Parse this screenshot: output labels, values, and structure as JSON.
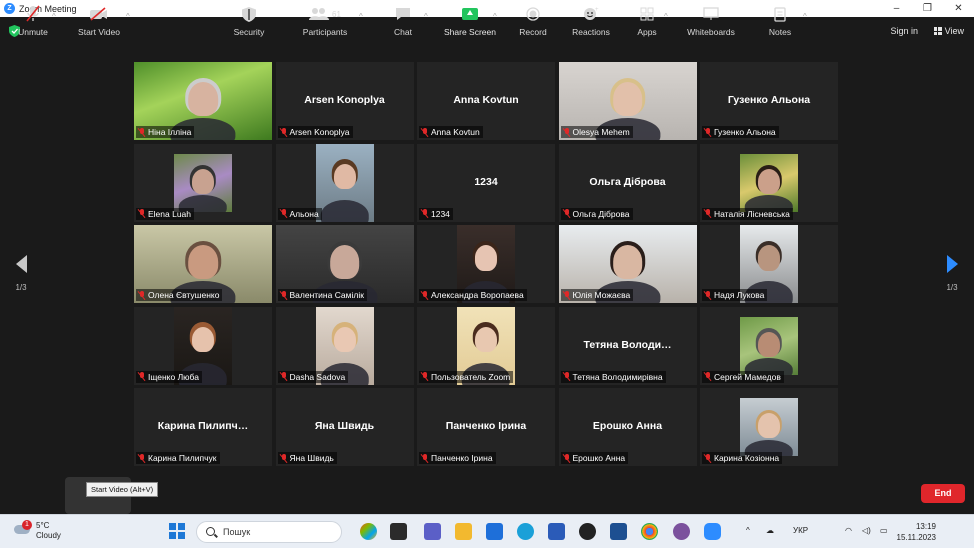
{
  "window": {
    "title": "Zoom Meeting",
    "controls": [
      "–",
      "❐",
      "✕"
    ]
  },
  "topbar": {
    "sign_in": "Sign in",
    "view": "View"
  },
  "pager": {
    "left": "1/3",
    "right": "1/3"
  },
  "tiles": [
    {
      "name": "Ніна Ілліна",
      "big": "",
      "video": "grass",
      "active": true
    },
    {
      "name": "Arsen Konoplya",
      "big": "Arsen Konoplya",
      "video": ""
    },
    {
      "name": "Anna Kovtun",
      "big": "Anna Kovtun",
      "video": ""
    },
    {
      "name": "Olesya Mehem",
      "big": "",
      "video": "office"
    },
    {
      "name": "Гузенко Альона",
      "big": "Гузенко Альона",
      "video": ""
    },
    {
      "name": "Elena Luah",
      "big": "",
      "video": "lilac"
    },
    {
      "name": "Альона",
      "big": "",
      "video": "bus"
    },
    {
      "name": "1234",
      "big": "1234",
      "video": ""
    },
    {
      "name": "Ольга Діброва",
      "big": "Ольга Діброва",
      "video": ""
    },
    {
      "name": "Наталія Лісневська",
      "big": "",
      "video": "garden"
    },
    {
      "name": "Олена Євтушенко",
      "big": "",
      "video": "room-wide"
    },
    {
      "name": "Валентина Самілік",
      "big": "",
      "video": "dark-room"
    },
    {
      "name": "Александра Воропаева",
      "big": "",
      "video": "girl-dark"
    },
    {
      "name": "Юлія Можаєва",
      "big": "",
      "video": "window-wide"
    },
    {
      "name": "Надя Лукова",
      "big": "",
      "video": "window-man"
    },
    {
      "name": "Іщенко Люба",
      "big": "",
      "video": "curly"
    },
    {
      "name": "Dasha Sadova",
      "big": "",
      "video": "blonde"
    },
    {
      "name": "Пользователь Zoom",
      "big": "",
      "video": "beige"
    },
    {
      "name": "Тетяна Володимирівна",
      "big": "Тетяна Володи…",
      "video": ""
    },
    {
      "name": "Сергей Мамедов",
      "big": "",
      "video": "man-outdoor"
    },
    {
      "name": "Карина Пилипчук",
      "big": "Карина Пилипч…",
      "video": ""
    },
    {
      "name": "Яна Швидь",
      "big": "Яна Швидь",
      "video": ""
    },
    {
      "name": "Панченко Ірина",
      "big": "Панченко Ірина",
      "video": ""
    },
    {
      "name": "Ерошко Анна",
      "big": "Ерошко Анна",
      "video": ""
    },
    {
      "name": "Карина Козіонна",
      "big": "",
      "video": "sofa"
    }
  ],
  "toolbar": {
    "unmute": "Unmute",
    "start_video": "Start Video",
    "tooltip": "Start Video (Alt+V)",
    "security": "Security",
    "participants": "Participants",
    "participants_count": "61",
    "chat": "Chat",
    "share_screen": "Share Screen",
    "record": "Record",
    "reactions": "Reactions",
    "apps": "Apps",
    "whiteboards": "Whiteboards",
    "notes": "Notes",
    "end": "End"
  },
  "taskbar": {
    "weather_temp": "5°C",
    "weather_desc": "Cloudy",
    "weather_badge": "1",
    "search_placeholder": "Пошук",
    "language": "УКР",
    "time": "13:19",
    "date": "15.11.2023"
  },
  "colors": {
    "accent": "#2d8cff",
    "active_border": "#e8e36a",
    "end": "#e0262b",
    "share": "#22c55e",
    "mic_off": "#e02828"
  }
}
